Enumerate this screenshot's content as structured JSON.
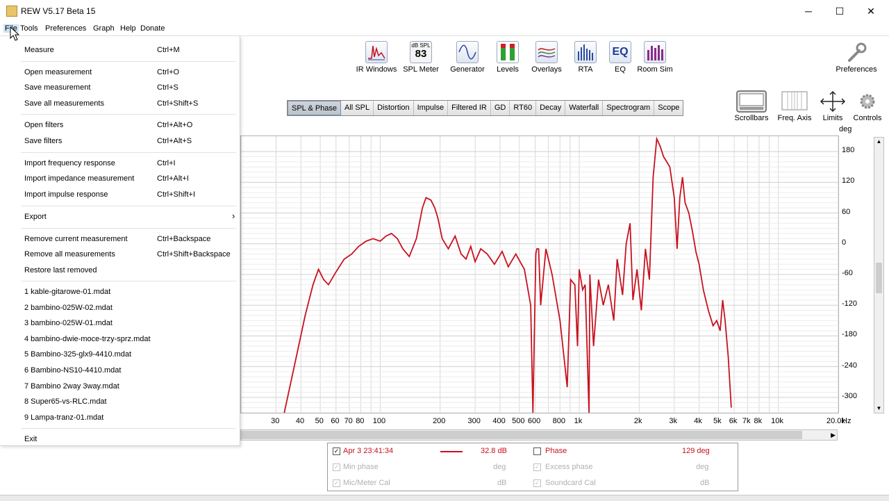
{
  "window": {
    "title": "REW V5.17 Beta 15",
    "minimize": "─",
    "maximize": "☐",
    "close": "✕"
  },
  "menubar": [
    "File",
    "Tools",
    "Preferences",
    "Graph",
    "Help",
    "Donate"
  ],
  "toolbar": [
    {
      "label": "IR Windows",
      "icon": "ir-windows-icon"
    },
    {
      "label": "SPL Meter",
      "icon": "spl-meter-icon",
      "top_text": "dB SPL",
      "value": "83"
    },
    {
      "label": "Generator",
      "icon": "generator-icon"
    },
    {
      "label": "Levels",
      "icon": "levels-icon"
    },
    {
      "label": "Overlays",
      "icon": "overlays-icon"
    },
    {
      "label": "RTA",
      "icon": "rta-icon"
    },
    {
      "label": "EQ",
      "icon": "eq-icon",
      "text": "EQ"
    },
    {
      "label": "Room Sim",
      "icon": "room-sim-icon"
    }
  ],
  "preferences_label": "Preferences",
  "tabs": [
    "SPL & Phase",
    "All SPL",
    "Distortion",
    "Impulse",
    "Filtered IR",
    "GD",
    "RT60",
    "Decay",
    "Waterfall",
    "Spectrogram",
    "Scope"
  ],
  "active_tab": "SPL & Phase",
  "controls": [
    "Scrollbars",
    "Freq. Axis",
    "Limits",
    "Controls"
  ],
  "graph": {
    "y_unit": "deg",
    "x_unit": "Hz",
    "y_ticks": [
      "180",
      "120",
      "60",
      "0",
      "-60",
      "-120",
      "-180",
      "-240",
      "-300"
    ],
    "x_ticks": [
      "30",
      "40",
      "50",
      "60",
      "70",
      "80",
      "100",
      "200",
      "300",
      "400",
      "500",
      "600",
      "800",
      "1k",
      "2k",
      "3k",
      "4k",
      "5k",
      "6k",
      "7k",
      "8k",
      "10k",
      "20.0k"
    ],
    "trace_color": "#c8101e"
  },
  "legend": {
    "row1": {
      "name": "Apr 3 23:41:34",
      "value": "32.8 dB",
      "phase_label": "Phase",
      "phase_value": "129 deg"
    },
    "row2": {
      "left": "Min phase",
      "left_unit": "deg",
      "right": "Excess phase",
      "right_unit": "deg"
    },
    "row3": {
      "left": "Mic/Meter Cal",
      "left_unit": "dB",
      "right": "Soundcard Cal",
      "right_unit": "dB"
    }
  },
  "file_menu": {
    "items": [
      {
        "label": "Measure",
        "shortcut": "Ctrl+M"
      },
      {
        "label": "Open measurement",
        "shortcut": "Ctrl+O"
      },
      {
        "label": "Save measurement",
        "shortcut": "Ctrl+S"
      },
      {
        "label": "Save all measurements",
        "shortcut": "Ctrl+Shift+S"
      },
      {
        "label": "Open filters",
        "shortcut": "Ctrl+Alt+O"
      },
      {
        "label": "Save filters",
        "shortcut": "Ctrl+Alt+S"
      },
      {
        "label": "Import frequency response",
        "shortcut": "Ctrl+I"
      },
      {
        "label": "Import impedance measurement",
        "shortcut": "Ctrl+Alt+I"
      },
      {
        "label": "Import impulse response",
        "shortcut": "Ctrl+Shift+I"
      },
      {
        "label": "Export",
        "shortcut": "›"
      },
      {
        "label": "Remove current measurement",
        "shortcut": "Ctrl+Backspace"
      },
      {
        "label": "Remove all measurements",
        "shortcut": "Ctrl+Shift+Backspace"
      },
      {
        "label": "Restore last removed",
        "shortcut": ""
      },
      {
        "label": "1 kable-gitarowe-01.mdat",
        "shortcut": ""
      },
      {
        "label": "2 bambino-025W-02.mdat",
        "shortcut": ""
      },
      {
        "label": "3 bambino-025W-01.mdat",
        "shortcut": ""
      },
      {
        "label": "4 bambino-dwie-moce-trzy-sprz.mdat",
        "shortcut": ""
      },
      {
        "label": "5 Bambino-325-glx9-4410.mdat",
        "shortcut": ""
      },
      {
        "label": "6 Bambino-NS10-4410.mdat",
        "shortcut": ""
      },
      {
        "label": "7 Bambino 2way 3way.mdat",
        "shortcut": ""
      },
      {
        "label": "8 Super65-vs-RLC.mdat",
        "shortcut": ""
      },
      {
        "label": "9 Lampa-tranz-01.mdat",
        "shortcut": ""
      },
      {
        "label": "Exit",
        "shortcut": ""
      }
    ]
  }
}
